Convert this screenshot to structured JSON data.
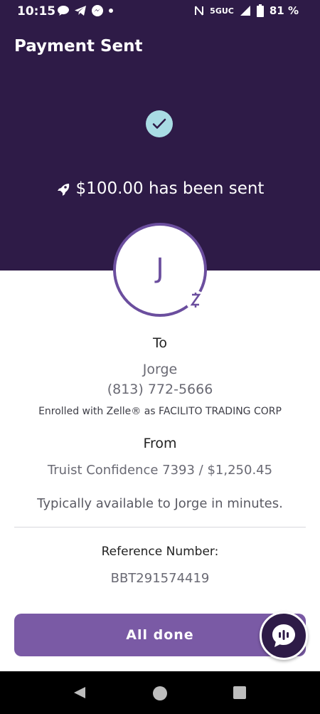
{
  "status_bar": {
    "time": "10:15",
    "network": "5GUC",
    "battery": "81 %"
  },
  "header": {
    "title": "Payment Sent"
  },
  "confirmation": {
    "sent_message": "$100.00 has been sent",
    "avatar_initial": "J"
  },
  "recipient": {
    "to_label": "To",
    "name": "Jorge",
    "phone": "(813) 772-5666",
    "enrolled_text": "Enrolled with Zelle® as FACILITO TRADING CORP"
  },
  "sender": {
    "from_label": "From",
    "account": "Truist Confidence 7393 / $1,250.45"
  },
  "availability": "Typically available to Jorge in minutes.",
  "reference": {
    "label": "Reference Number:",
    "number": "BBT291574419"
  },
  "actions": {
    "done_label": "All done"
  },
  "colors": {
    "header_bg": "#2e1b47",
    "accent": "#7a5aa5",
    "check_bg": "#a9dce4"
  },
  "icons": [
    "check-icon",
    "rocket-icon",
    "zelle-icon",
    "chat-icon",
    "back-icon",
    "home-icon",
    "recents-icon"
  ]
}
